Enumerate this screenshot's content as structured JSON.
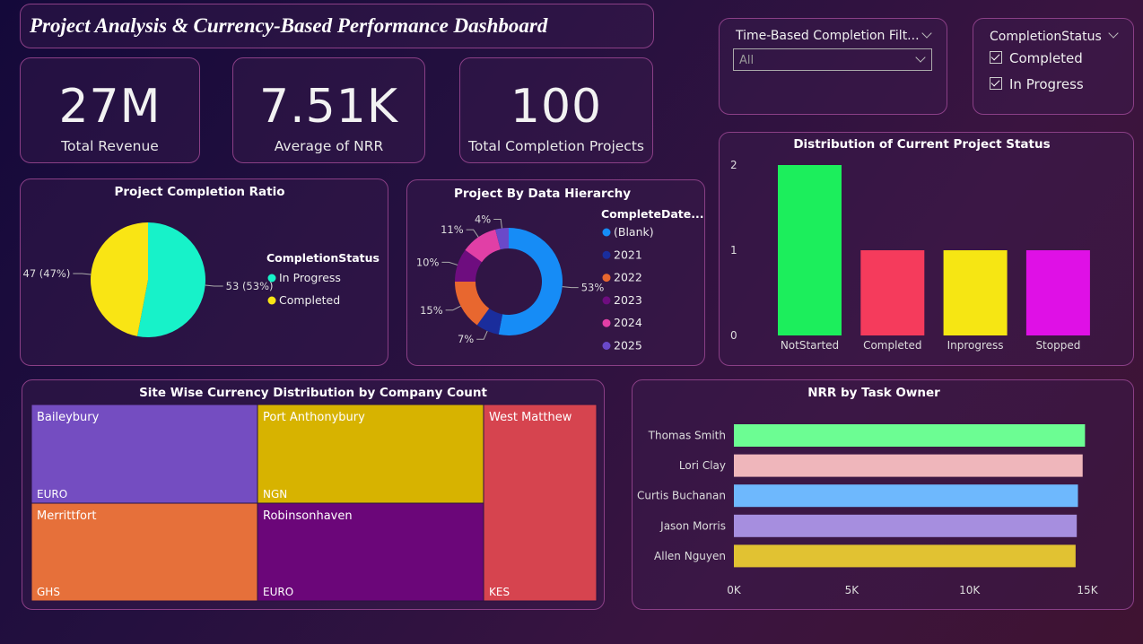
{
  "header": {
    "title": "Project Analysis & Currency-Based Performance Dashboard"
  },
  "kpis": [
    {
      "value": "27M",
      "label": "Total Revenue"
    },
    {
      "value": "7.51K",
      "label": "Average of NRR"
    },
    {
      "value": "100",
      "label": "Total Completion Projects"
    }
  ],
  "time_filter": {
    "title": "Time-Based Completion Filt...",
    "selected": "All"
  },
  "status_filter": {
    "title": "CompletionStatus",
    "options": [
      {
        "label": "Completed",
        "checked": true
      },
      {
        "label": "In Progress",
        "checked": true
      }
    ]
  },
  "colors": {
    "in_progress": "#17f2c9",
    "completed": "#f9e514",
    "notstarted": "#1cee5c",
    "status_completed": "#f53b5c",
    "inprogress": "#f6e613",
    "stopped": "#df10e6"
  },
  "chart_data": [
    {
      "id": "completion_ratio",
      "type": "pie",
      "title": "Project Completion Ratio",
      "legend_title": "CompletionStatus",
      "legend_position": "right",
      "slices": [
        {
          "name": "In Progress",
          "value": 53,
          "label": "53 (53%)",
          "color": "#17f2c9"
        },
        {
          "name": "Completed",
          "value": 47,
          "label": "47 (47%)",
          "color": "#f9e514"
        }
      ]
    },
    {
      "id": "data_hierarchy",
      "type": "pie",
      "title": "Project By Data Hierarchy",
      "legend_title": "CompleteDate...",
      "legend_position": "right",
      "slices": [
        {
          "name": "(Blank)",
          "value": 53,
          "label": "53%",
          "color": "#168cf6"
        },
        {
          "name": "2021",
          "value": 7,
          "label": "7%",
          "color": "#1a2d9c"
        },
        {
          "name": "2022",
          "value": 15,
          "label": "15%",
          "color": "#e8672f"
        },
        {
          "name": "2023",
          "value": 10,
          "label": "10%",
          "color": "#6e0d7f"
        },
        {
          "name": "2024",
          "value": 11,
          "label": "11%",
          "color": "#e13fa6"
        },
        {
          "name": "2025",
          "value": 4,
          "label": "4%",
          "color": "#6a49c9"
        }
      ]
    },
    {
      "id": "project_status",
      "type": "bar",
      "title": "Distribution of Current Project Status",
      "categories": [
        "NotStarted",
        "Completed",
        "Inprogress",
        "Stopped"
      ],
      "values": [
        2,
        1,
        1,
        1
      ],
      "colors": [
        "#1cee5c",
        "#f53b5c",
        "#f6e613",
        "#df10e6"
      ],
      "yticks": [
        "0",
        "1",
        "2"
      ],
      "ylim": [
        0,
        2
      ]
    },
    {
      "id": "currency_treemap",
      "type": "treemap",
      "title": "Site Wise Currency Distribution by Company Count",
      "cells": [
        {
          "site": "Baileybury",
          "currency": "EURO",
          "color": "#744dc1"
        },
        {
          "site": "Port Anthonybury",
          "currency": "NGN",
          "color": "#d7b300"
        },
        {
          "site": "West Matthew",
          "currency": "KES",
          "color": "#d6444f"
        },
        {
          "site": "Merrittfort",
          "currency": "GHS",
          "color": "#e6703a"
        },
        {
          "site": "Robinsonhaven",
          "currency": "EURO",
          "color": "#6b0679"
        }
      ]
    },
    {
      "id": "nrr_by_owner",
      "type": "bar",
      "orientation": "horizontal",
      "title": "NRR by Task Owner",
      "categories": [
        "Thomas Smith",
        "Lori Clay",
        "Curtis Buchanan",
        "Jason Morris",
        "Allen Nguyen"
      ],
      "values": [
        14.9,
        14.8,
        14.6,
        14.55,
        14.5
      ],
      "colors": [
        "#6cfd93",
        "#efb6bb",
        "#6eb8fd",
        "#a68edf",
        "#e1c232"
      ],
      "xticks": [
        "0K",
        "5K",
        "10K",
        "15K"
      ],
      "xlim": [
        0,
        15
      ]
    }
  ]
}
